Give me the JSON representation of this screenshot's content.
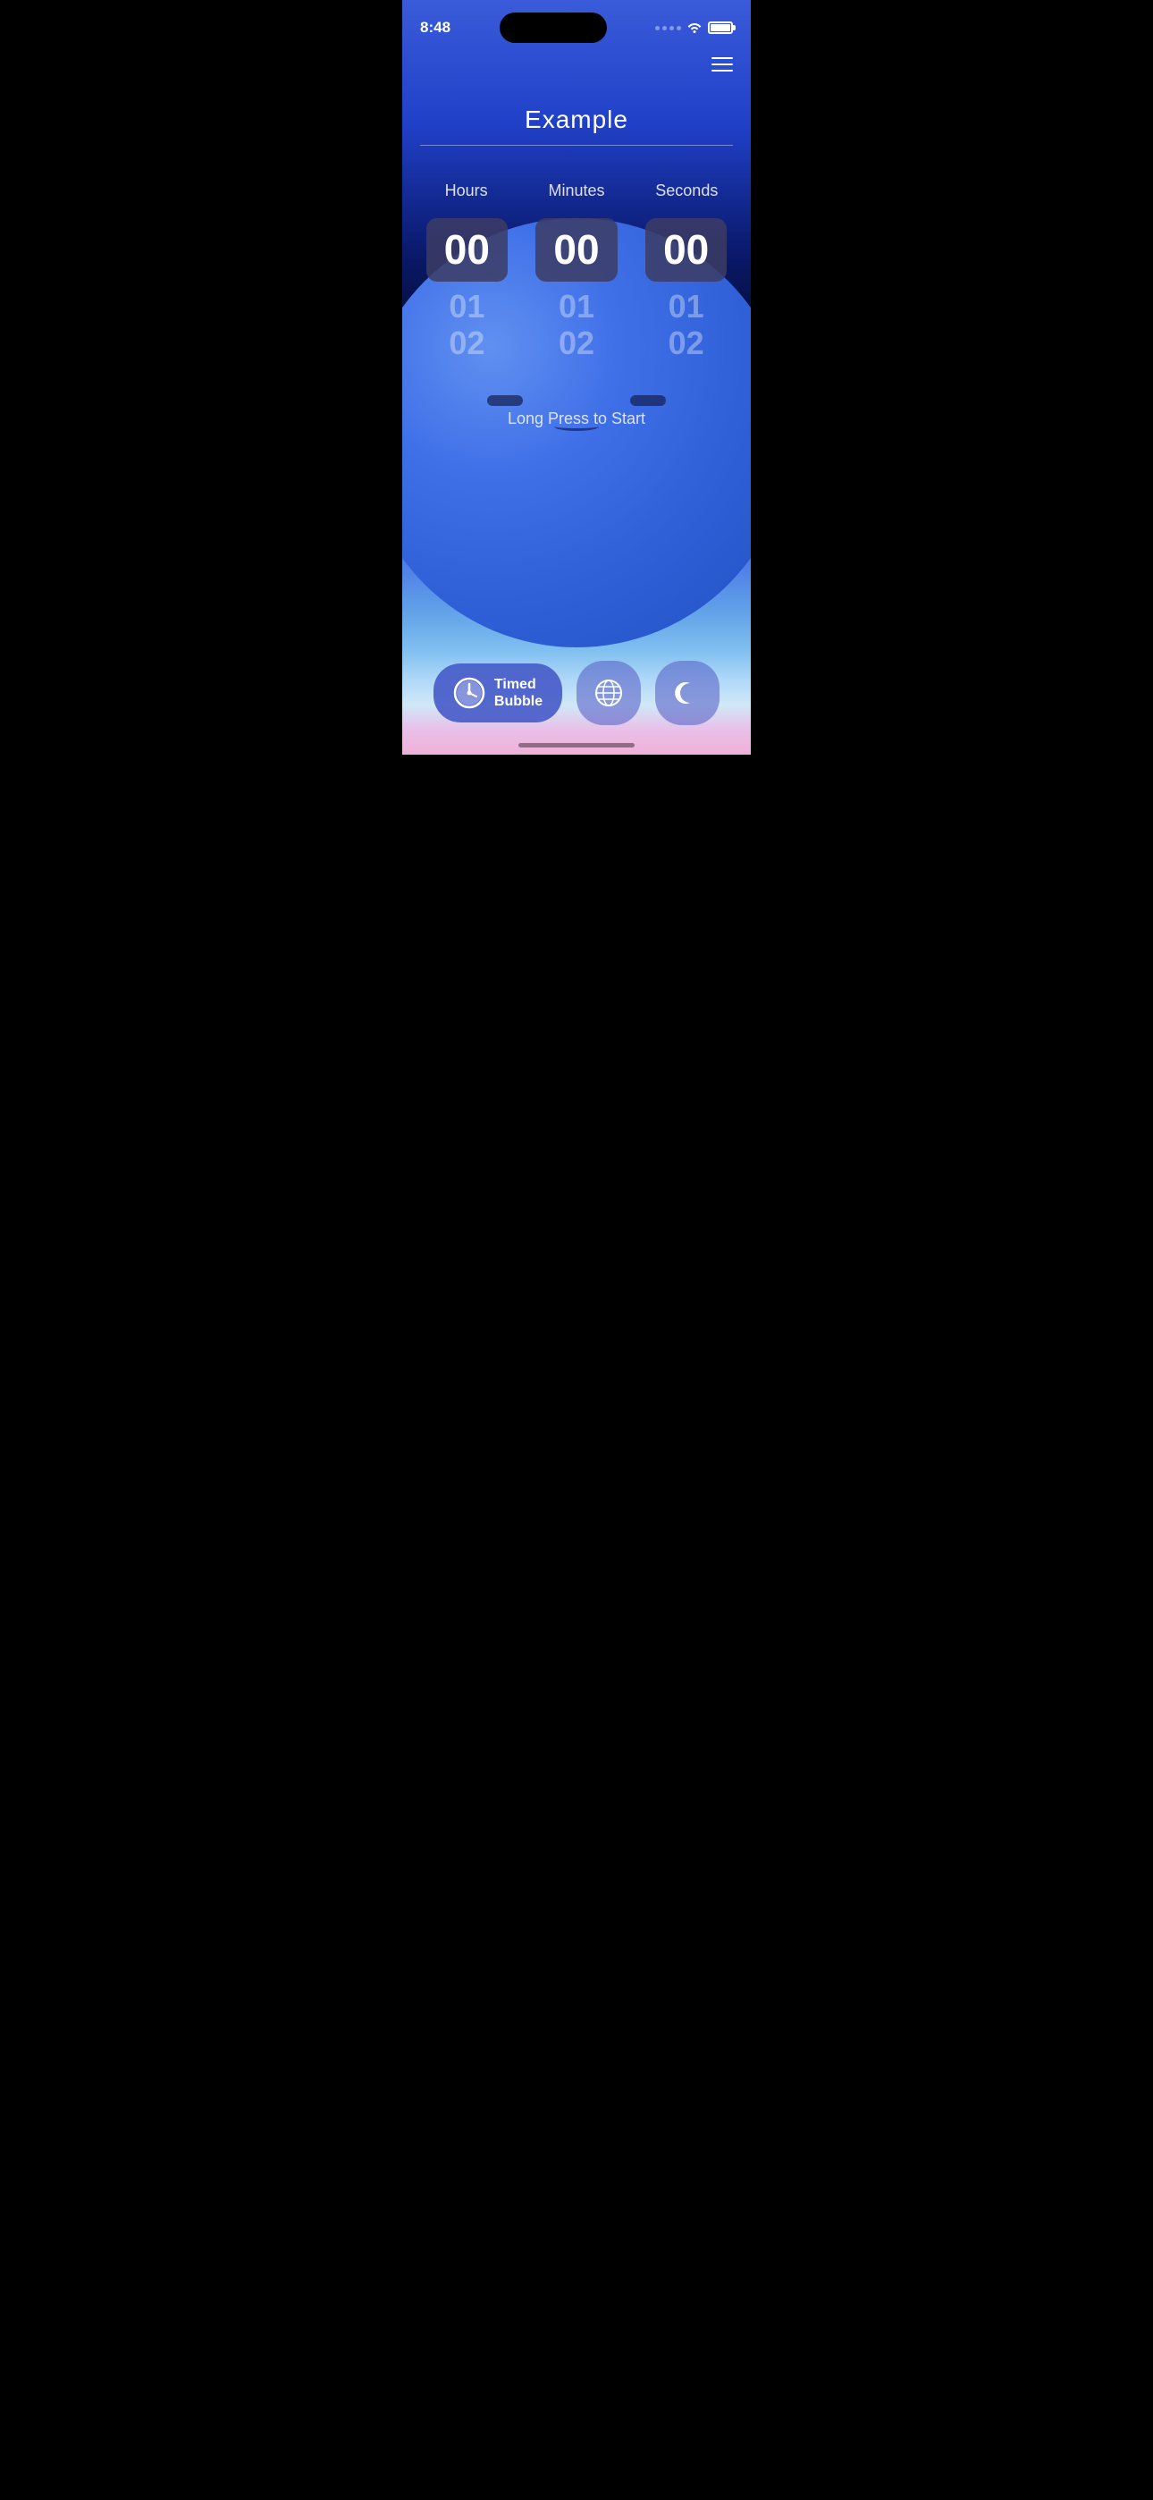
{
  "statusBar": {
    "time": "8:48",
    "timeLabel": "current time"
  },
  "header": {
    "menuLabel": "menu"
  },
  "title": {
    "appName": "Example"
  },
  "timer": {
    "labels": [
      "Hours",
      "Minutes",
      "Seconds"
    ],
    "hours": {
      "selected": "00",
      "below1": "01",
      "below2": "02"
    },
    "minutes": {
      "selected": "00",
      "below1": "01",
      "below2": "02"
    },
    "seconds": {
      "selected": "00",
      "below1": "01",
      "below2": "02"
    }
  },
  "longPress": {
    "text": "Long Press to Start"
  },
  "tabBar": {
    "items": [
      {
        "id": "timed-bubble",
        "label1": "Timed",
        "label2": "Bubble",
        "active": true
      },
      {
        "id": "globe",
        "label": "",
        "active": false
      },
      {
        "id": "moon",
        "label": "",
        "active": false
      }
    ]
  }
}
